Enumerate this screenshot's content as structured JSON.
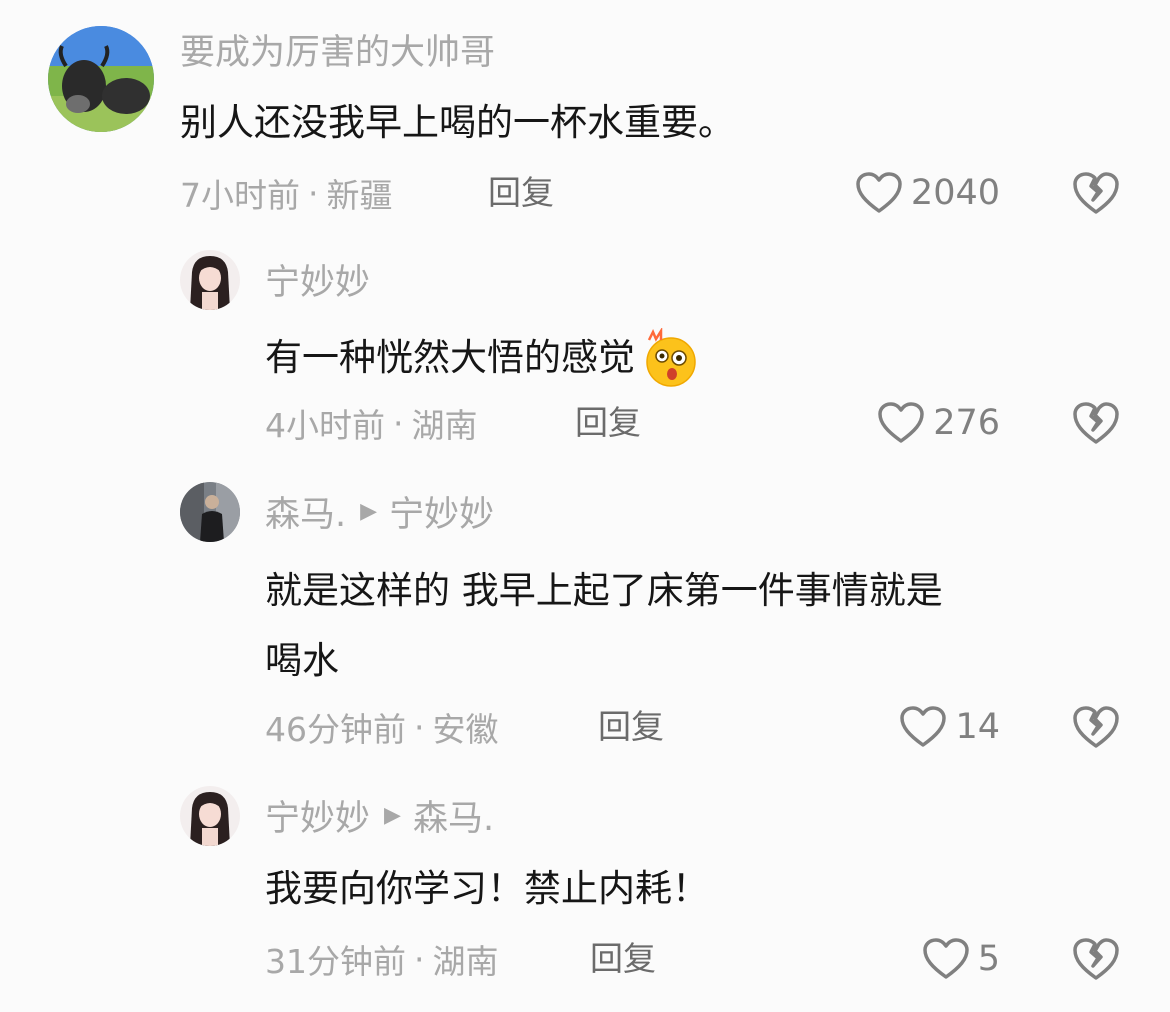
{
  "comments": [
    {
      "username": "要成为厉害的大帅哥",
      "reply_to": "",
      "text": "别人还没我早上喝的一杯水重要。",
      "time": "7小时前",
      "location": "新疆",
      "reply_label": "回复",
      "likes": "2040",
      "avatar_icon": "cow-avatar"
    },
    {
      "username": "宁妙妙",
      "reply_to": "",
      "text": "有一种恍然大悟的感觉",
      "emoji": "astonished-emoji",
      "time": "4小时前",
      "location": "湖南",
      "reply_label": "回复",
      "likes": "276",
      "avatar_icon": "girl-avatar"
    },
    {
      "username": "森马.",
      "reply_to": "宁妙妙",
      "text_line1": "就是这样的 我早上起了床第一件事情就是",
      "text_line2": "喝水",
      "time": "46分钟前",
      "location": "安徽",
      "reply_label": "回复",
      "likes": "14",
      "avatar_icon": "person-avatar"
    },
    {
      "username": "宁妙妙",
      "reply_to": "森马.",
      "text": "我要向你学习！禁止内耗！",
      "time": "31分钟前",
      "location": "湖南",
      "reply_label": "回复",
      "likes": "5",
      "avatar_icon": "girl-avatar"
    }
  ],
  "separator": "·",
  "colors": {
    "text": "#161616",
    "meta": "#a8a8a8",
    "icon": "#808080"
  }
}
